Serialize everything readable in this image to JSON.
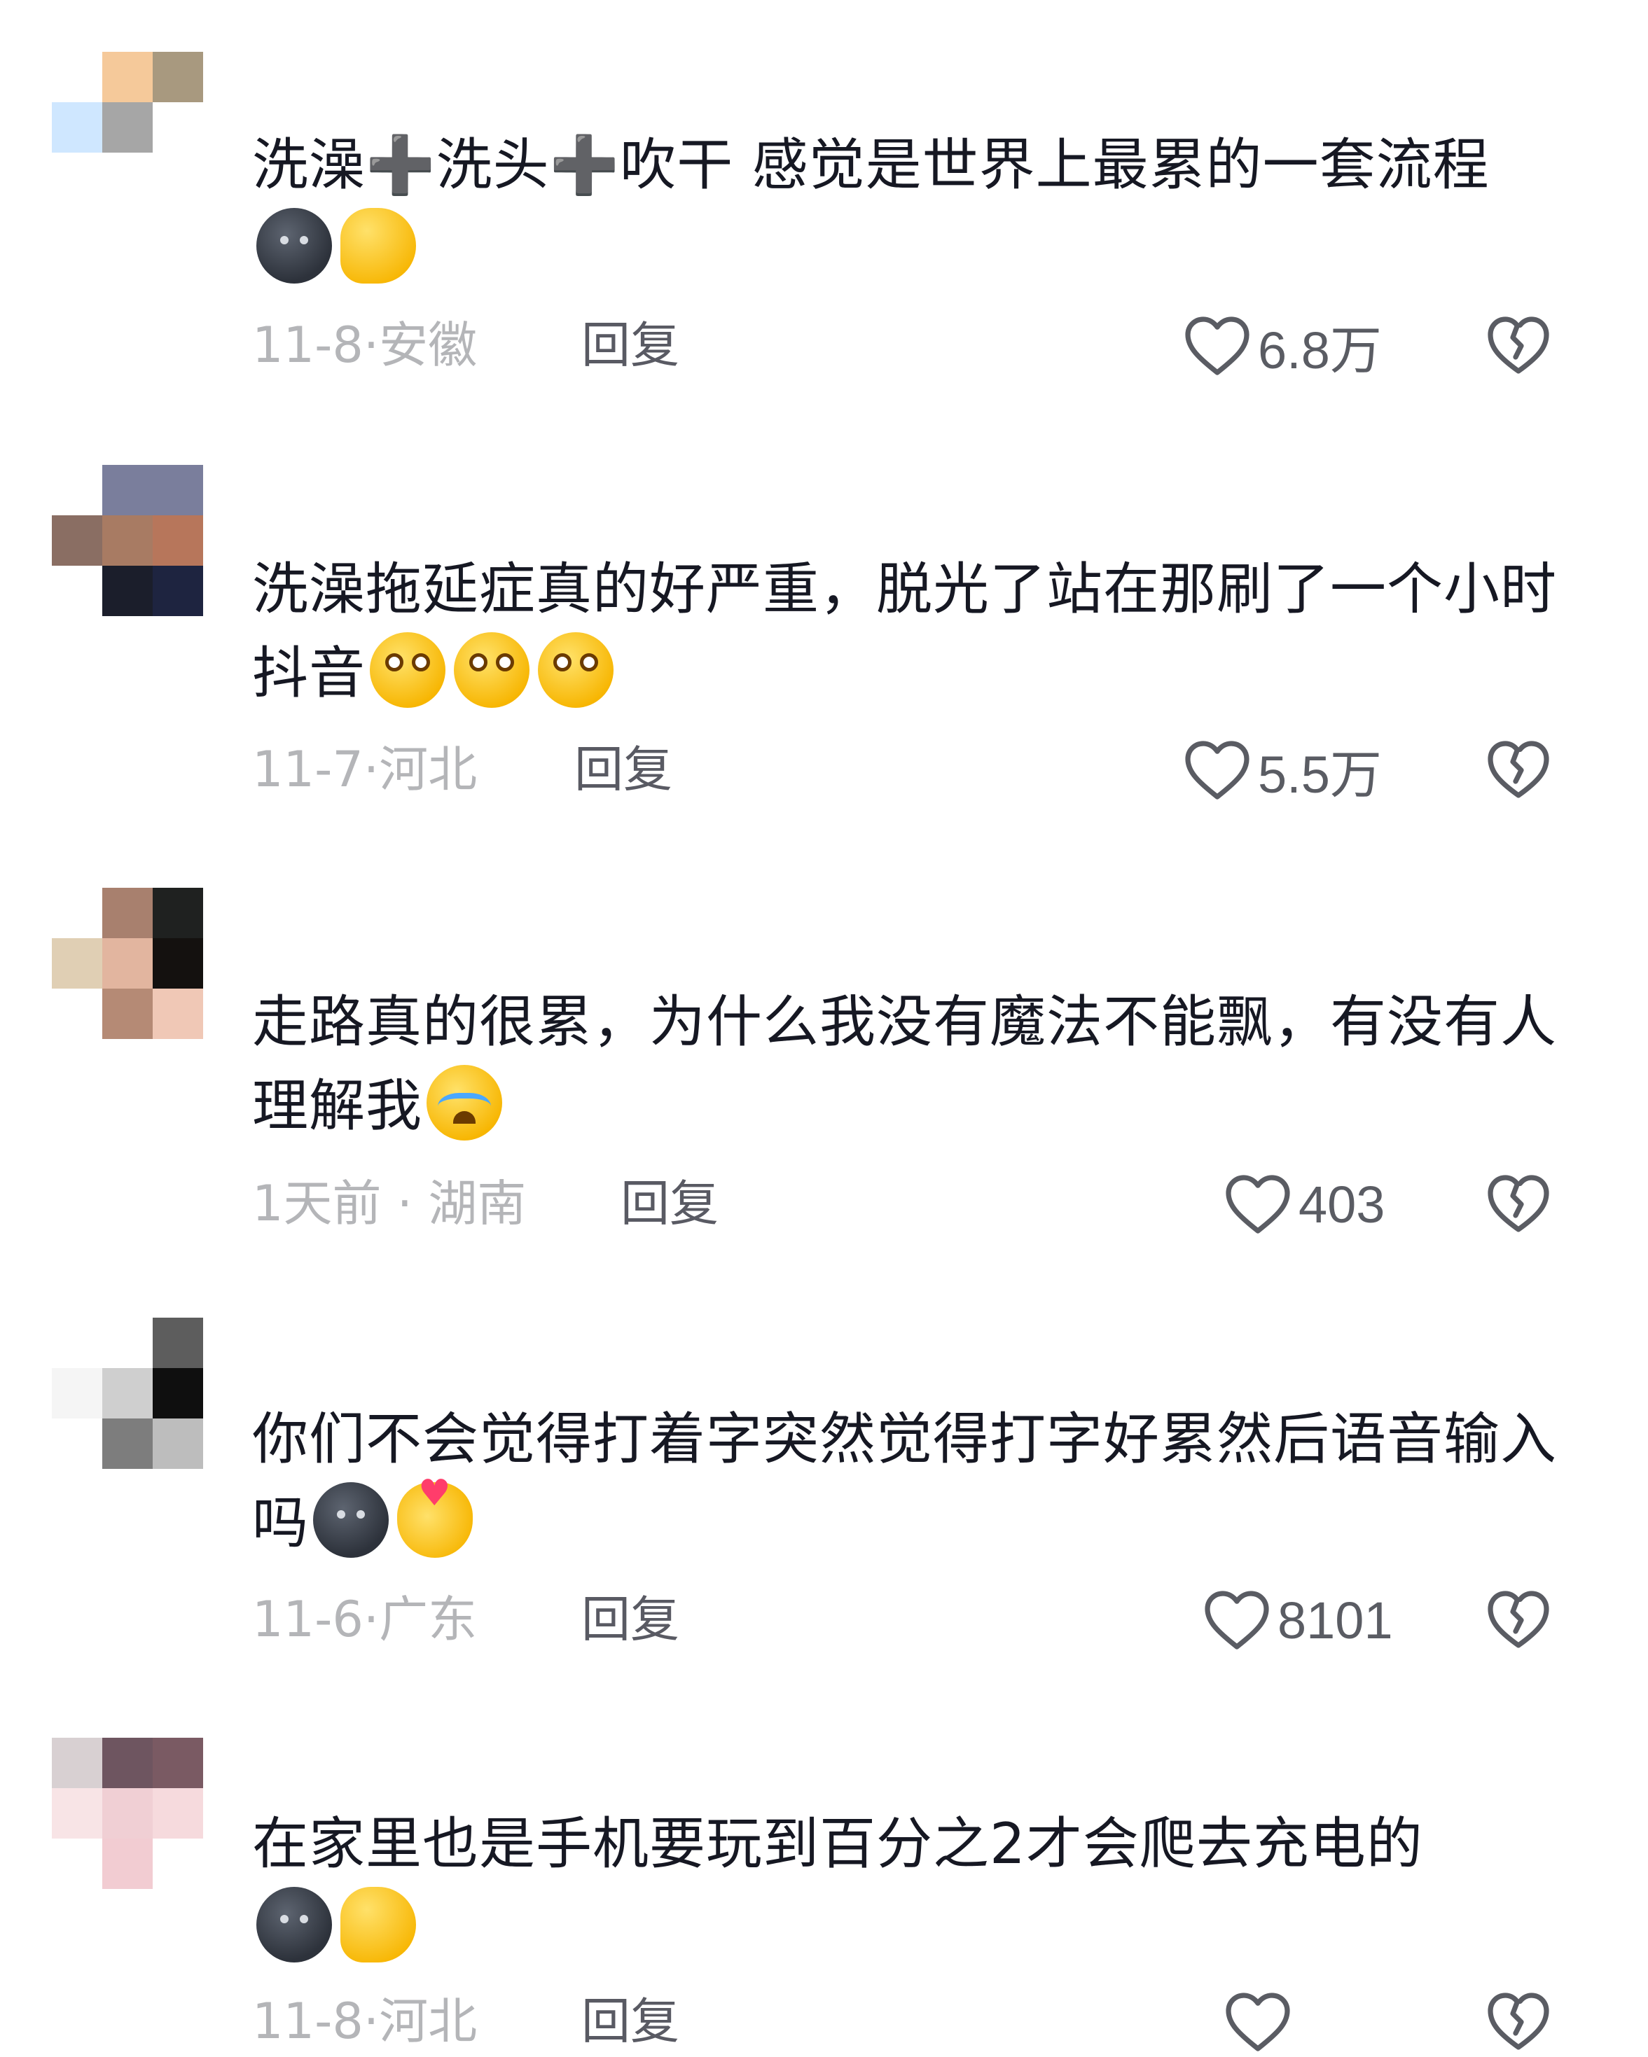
{
  "comments": [
    {
      "avatar_colors": [
        "#ffffff",
        "#f5c99a",
        "#a8997f",
        "#cfe7ff",
        "#a6a6a6",
        "#ffffff",
        "#ffffff",
        "#ffffff",
        "#ffffff"
      ],
      "text": "洗澡➕洗头➕吹干  感觉是世界上最累的一套流程",
      "emojis": [
        "moon",
        "muscle"
      ],
      "date": "11-8",
      "location": "安徽",
      "reply_label": "回复",
      "likes": "6.8万"
    },
    {
      "avatar_colors": [
        "#ffffff",
        "#7a7e9c",
        "#7a7e9c",
        "#8a6e63",
        "#a87b63",
        "#b7765b",
        "#ffffff",
        "#1b1e2b",
        "#1e2440"
      ],
      "text": "洗澡拖延症真的好严重，脱光了站在那刷了一个小时抖音",
      "emojis": [
        "smile",
        "smile",
        "smile"
      ],
      "date": "11-7",
      "location": "河北",
      "reply_label": "回复",
      "likes": "5.5万"
    },
    {
      "avatar_colors": [
        "#ffffff",
        "#a8806e",
        "#1f2120",
        "#e0cfb4",
        "#e2b59f",
        "#14110f",
        "#ffffff",
        "#b58a75",
        "#f0c8b6"
      ],
      "text": "走路真的很累，为什么我没有魔法不能飘，有没有人理解我",
      "emojis": [
        "cry"
      ],
      "date": "1天前",
      "location": "湖南",
      "reply_label": "回复",
      "likes": "403"
    },
    {
      "avatar_colors": [
        "#ffffff",
        "#ffffff",
        "#5d5d5d",
        "#f5f5f5",
        "#cfcfcf",
        "#0f0f0f",
        "#ffffff",
        "#7d7d7d",
        "#bdbdbd"
      ],
      "text": "你们不会觉得打着字突然觉得打字好累然后语音输入吗",
      "emojis": [
        "moon",
        "fingerheart"
      ],
      "date": "11-6",
      "location": "广东",
      "reply_label": "回复",
      "likes": "8101"
    },
    {
      "avatar_colors": [
        "#d8d0d2",
        "#6e5560",
        "#7a5a63",
        "#f8e4e6",
        "#f0cfd4",
        "#f6dadd",
        "#ffffff",
        "#f2ccd2",
        "#ffffff"
      ],
      "text": "在家里也是手机要玩到百分之2才会爬去充电的",
      "emojis": [
        "moon",
        "muscle"
      ],
      "date": "11-8",
      "location": "河北",
      "reply_label": "回复",
      "likes": ""
    }
  ],
  "icons": {
    "like": "heart-outline-icon",
    "dislike": "broken-heart-icon"
  },
  "colors": {
    "text": "#161823",
    "meta": "#b4b5b8",
    "reply": "#595a63",
    "count": "#5a5c63"
  }
}
